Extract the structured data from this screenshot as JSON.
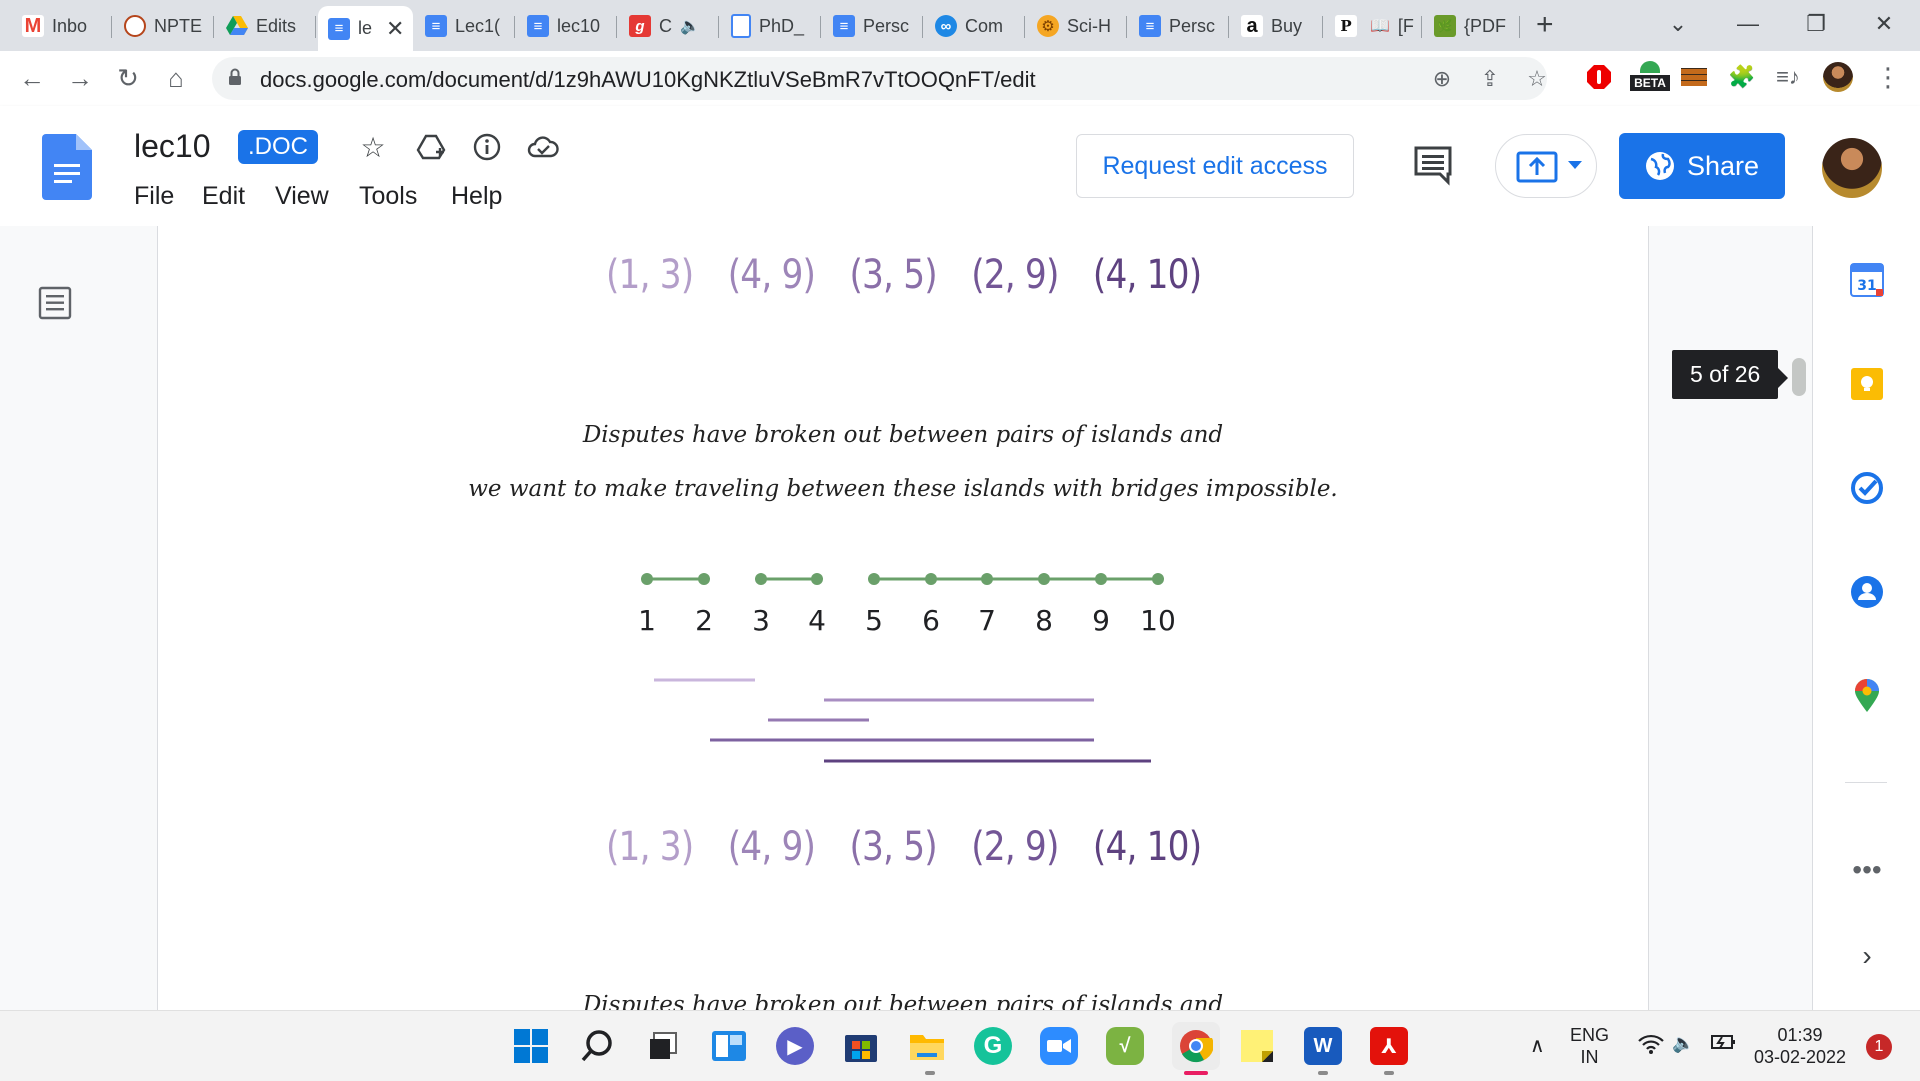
{
  "browser": {
    "tabs": [
      {
        "label": "Inbo",
        "icon": "gmail-icon"
      },
      {
        "label": "NPTE",
        "icon": "nptel-icon"
      },
      {
        "label": "Edits",
        "icon": "google-drive-icon"
      },
      {
        "label": "le",
        "icon": "google-docs-icon",
        "active": true
      },
      {
        "label": "Lec1(",
        "icon": "google-docs-icon"
      },
      {
        "label": "lec10",
        "icon": "google-docs-icon"
      },
      {
        "label": "C",
        "icon": "grammarly-icon"
      },
      {
        "label": "PhD_",
        "icon": "document-icon"
      },
      {
        "label": "Persc",
        "icon": "google-docs-icon"
      },
      {
        "label": "Com",
        "icon": "link-icon"
      },
      {
        "label": "Sci-H",
        "icon": "sci-hub-icon"
      },
      {
        "label": "Persc",
        "icon": "google-docs-icon"
      },
      {
        "label": "Buy",
        "icon": "amazon-icon"
      },
      {
        "label": "[F",
        "icon": "book-icon"
      },
      {
        "label": "{PDF",
        "icon": "pdf-site-icon"
      }
    ],
    "url": "docs.google.com/document/d/1z9hAWU10KgNKZtluVSeBmR7vTtOOQnFT/edit",
    "beta_label": "BETA"
  },
  "docs": {
    "title": "lec10",
    "badge": ".DOC",
    "menu": [
      "File",
      "Edit",
      "View",
      "Tools",
      "Help"
    ],
    "request_edit": "Request edit access",
    "share": "Share",
    "page_indicator": "5 of 26"
  },
  "content": {
    "pairs": [
      "(1, 3)",
      "(4, 9)",
      "(3, 5)",
      "(2, 9)",
      "(4, 10)"
    ],
    "pair_colors": [
      "#b39ec9",
      "#9d85b8",
      "#8a6fa8",
      "#735696",
      "#5e4280"
    ],
    "handwriting_line1": "Disputes have broken out between pairs of islands and",
    "handwriting_line2": "we want to make traveling between these islands with bridges impossible.",
    "island_numbers": [
      "1",
      "2",
      "3",
      "4",
      "5",
      "6",
      "7",
      "8",
      "9",
      "10"
    ],
    "bottom_pairs": [
      "(1, 3)",
      "(4, 9)",
      "(3, 5)",
      "(2, 9)",
      "(4, 10)"
    ],
    "cut_off_line": "Disputes have broken out between pairs of islands and"
  },
  "taskbar": {
    "lang": "ENG",
    "region": "IN",
    "time": "01:39",
    "date": "03-02-2022",
    "notifications": "1"
  }
}
